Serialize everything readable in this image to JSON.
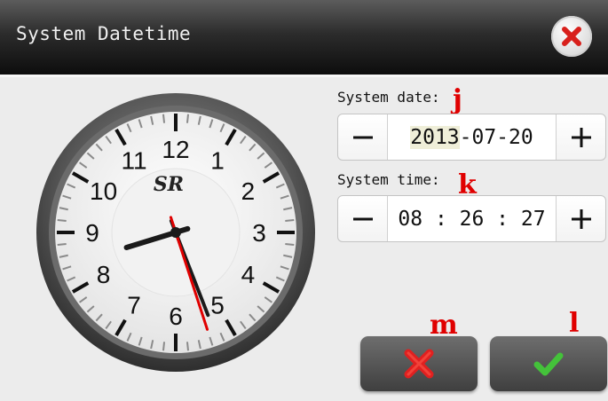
{
  "dialog": {
    "title": "System Datetime",
    "close_icon": "close-icon"
  },
  "clock": {
    "brand": "SR",
    "numbers": [
      "12",
      "1",
      "2",
      "3",
      "4",
      "5",
      "6",
      "7",
      "8",
      "9",
      "10",
      "11"
    ],
    "time": {
      "hours": 8,
      "minutes": 26,
      "seconds": 27
    }
  },
  "date_field": {
    "label": "System date:",
    "marker": "j",
    "year": "2013",
    "rest": "-07-20",
    "decrement": "minus-icon",
    "increment": "plus-icon"
  },
  "time_field": {
    "label": "System time:",
    "marker": "k",
    "value": "08 : 26 : 27",
    "decrement": "minus-icon",
    "increment": "plus-icon"
  },
  "actions": {
    "cancel_marker": "m",
    "confirm_marker": "l",
    "cancel_icon": "red-x-icon",
    "confirm_icon": "green-check-icon"
  },
  "colors": {
    "marker": "#e00000",
    "cancel_icon": "#e02020",
    "confirm_icon": "#44c23a",
    "second_hand": "#e00000"
  }
}
